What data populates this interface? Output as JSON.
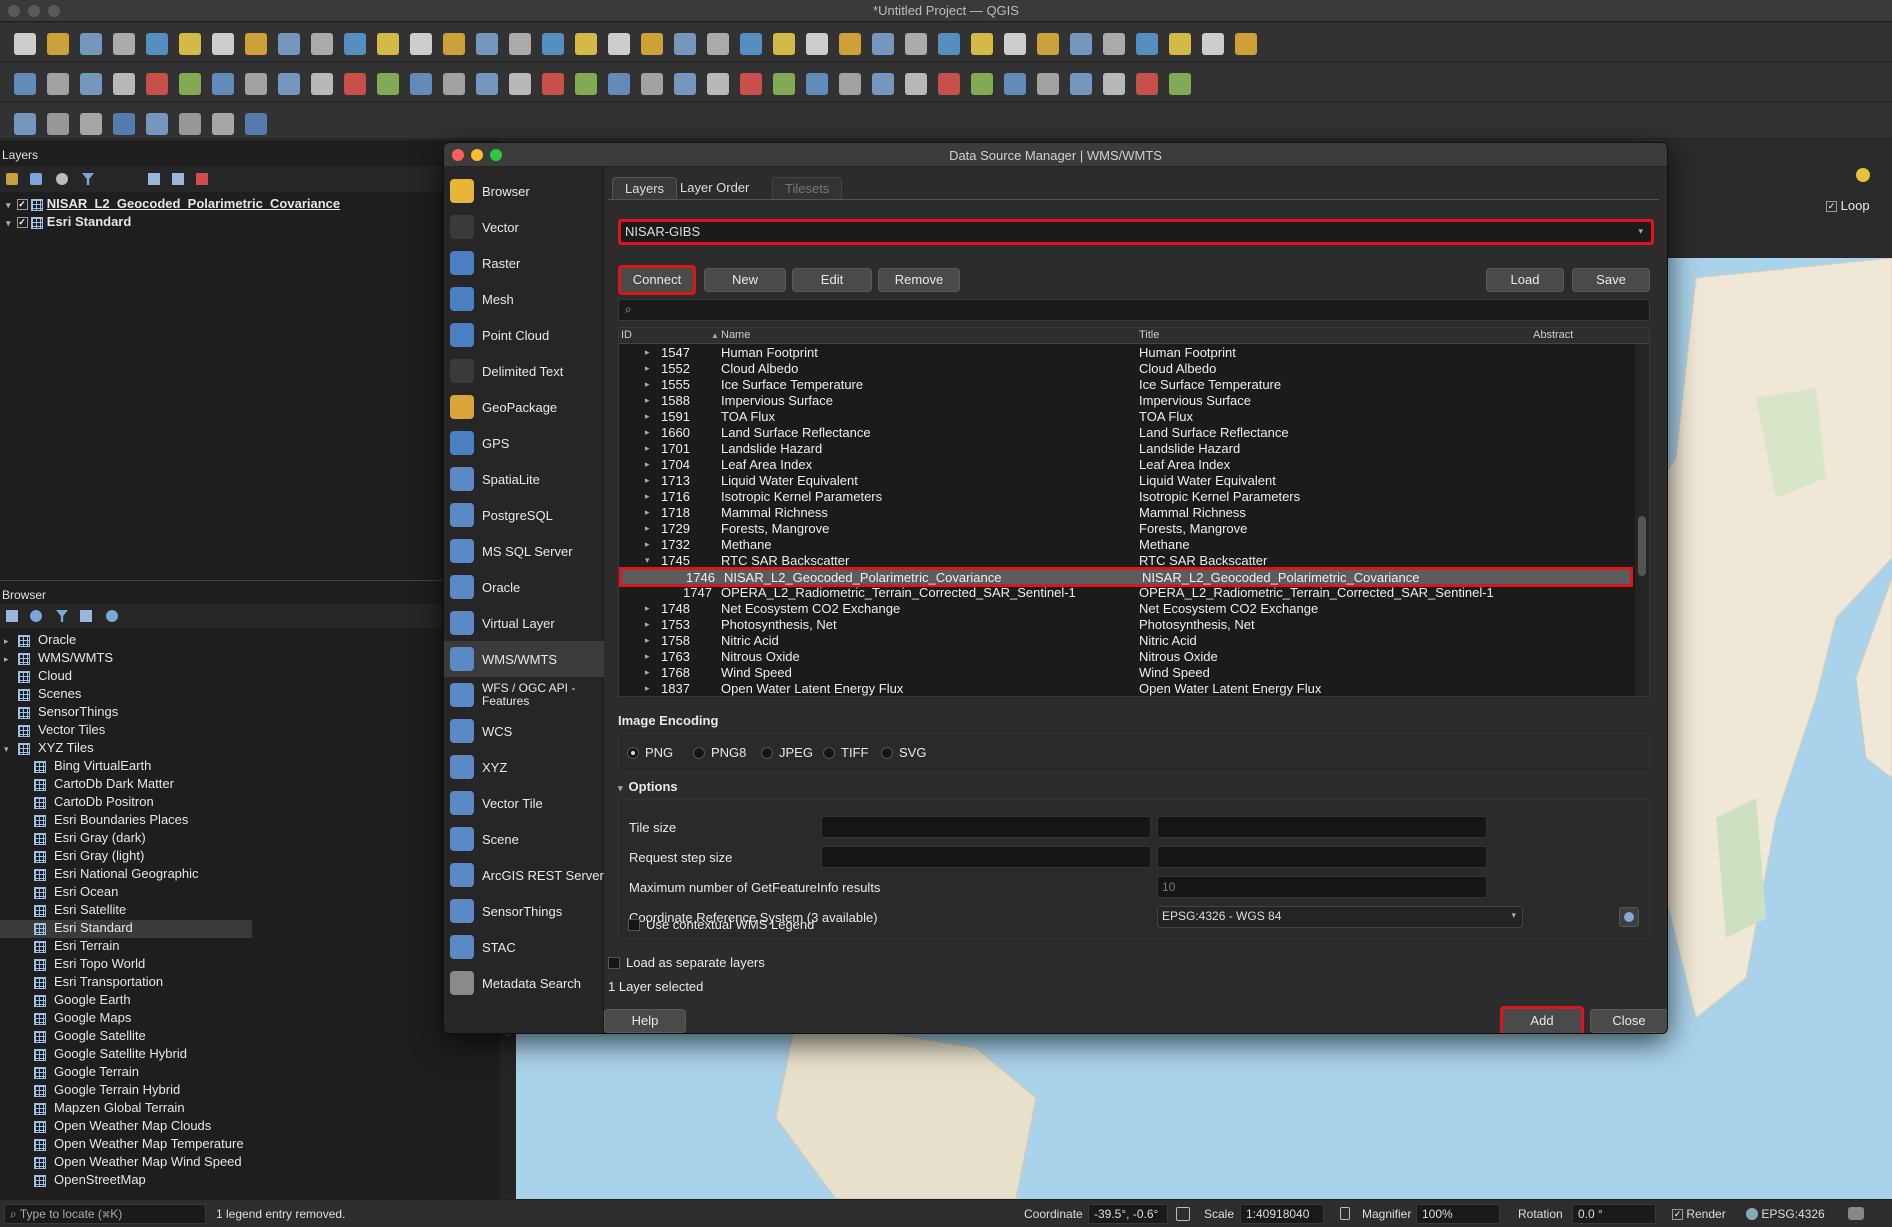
{
  "window": {
    "title": "*Untitled Project — QGIS"
  },
  "layers_panel": {
    "header": "Layers",
    "items": [
      {
        "name": "NISAR_L2_Geocoded_Polarimetric_Covariance",
        "checked": true
      },
      {
        "name": "Esri Standard",
        "checked": true
      }
    ]
  },
  "browser_panel": {
    "header": "Browser",
    "items": [
      {
        "label": "Oracle",
        "indent": 0,
        "expander": "▸"
      },
      {
        "label": "WMS/WMTS",
        "indent": 0,
        "expander": "▸"
      },
      {
        "label": "Cloud",
        "indent": 0,
        "expander": ""
      },
      {
        "label": "Scenes",
        "indent": 0,
        "expander": ""
      },
      {
        "label": "SensorThings",
        "indent": 0,
        "expander": ""
      },
      {
        "label": "Vector Tiles",
        "indent": 0,
        "expander": ""
      },
      {
        "label": "XYZ Tiles",
        "indent": 0,
        "expander": "▾"
      },
      {
        "label": "Bing VirtualEarth",
        "indent": 1
      },
      {
        "label": "CartoDb Dark Matter",
        "indent": 1
      },
      {
        "label": "CartoDb Positron",
        "indent": 1
      },
      {
        "label": "Esri Boundaries Places",
        "indent": 1
      },
      {
        "label": "Esri Gray (dark)",
        "indent": 1
      },
      {
        "label": "Esri Gray (light)",
        "indent": 1
      },
      {
        "label": "Esri National Geographic",
        "indent": 1
      },
      {
        "label": "Esri Ocean",
        "indent": 1
      },
      {
        "label": "Esri Satellite",
        "indent": 1
      },
      {
        "label": "Esri Standard",
        "indent": 1,
        "selected": true
      },
      {
        "label": "Esri Terrain",
        "indent": 1
      },
      {
        "label": "Esri Topo World",
        "indent": 1
      },
      {
        "label": "Esri Transportation",
        "indent": 1
      },
      {
        "label": "Google Earth",
        "indent": 1
      },
      {
        "label": "Google Maps",
        "indent": 1
      },
      {
        "label": "Google Satellite",
        "indent": 1
      },
      {
        "label": "Google Satellite Hybrid",
        "indent": 1
      },
      {
        "label": "Google Terrain",
        "indent": 1
      },
      {
        "label": "Google Terrain Hybrid",
        "indent": 1
      },
      {
        "label": "Mapzen Global Terrain",
        "indent": 1
      },
      {
        "label": "Open Weather Map Clouds",
        "indent": 1
      },
      {
        "label": "Open Weather Map Temperature",
        "indent": 1
      },
      {
        "label": "Open Weather Map Wind Speed",
        "indent": 1
      },
      {
        "label": "OpenStreetMap",
        "indent": 1
      }
    ]
  },
  "dialog": {
    "title": "Data Source Manager | WMS/WMTS",
    "sources": [
      {
        "label": "Browser",
        "icon": "folder-icon",
        "color": "#e8b53a"
      },
      {
        "label": "Vector",
        "icon": "vector-icon",
        "color": "#3a3a3a"
      },
      {
        "label": "Raster",
        "icon": "raster-icon",
        "color": "#4a7fc1"
      },
      {
        "label": "Mesh",
        "icon": "mesh-icon",
        "color": "#4a7fc1"
      },
      {
        "label": "Point Cloud",
        "icon": "point-cloud-icon",
        "color": "#4a7fc1"
      },
      {
        "label": "Delimited Text",
        "icon": "delimited-text-icon",
        "color": "#3a3a3a"
      },
      {
        "label": "GeoPackage",
        "icon": "geopackage-icon",
        "color": "#d9a43a"
      },
      {
        "label": "GPS",
        "icon": "gps-icon",
        "color": "#4a7fc1"
      },
      {
        "label": "SpatiaLite",
        "icon": "spatialite-icon",
        "color": "#5a8ac6"
      },
      {
        "label": "PostgreSQL",
        "icon": "postgresql-icon",
        "color": "#5a8ac6"
      },
      {
        "label": "MS SQL Server",
        "icon": "mssql-icon",
        "color": "#5a8ac6"
      },
      {
        "label": "Oracle",
        "icon": "oracle-icon",
        "color": "#5a8ac6"
      },
      {
        "label": "Virtual Layer",
        "icon": "virtual-layer-icon",
        "color": "#5a8ac6"
      },
      {
        "label": "WMS/WMTS",
        "icon": "wms-icon",
        "color": "#5a8ac6",
        "selected": true
      },
      {
        "label": "WFS / OGC API - Features",
        "icon": "wfs-icon",
        "color": "#5a8ac6"
      },
      {
        "label": "WCS",
        "icon": "wcs-icon",
        "color": "#5a8ac6"
      },
      {
        "label": "XYZ",
        "icon": "xyz-icon",
        "color": "#5a8ac6"
      },
      {
        "label": "Vector Tile",
        "icon": "vector-tile-icon",
        "color": "#5a8ac6"
      },
      {
        "label": "Scene",
        "icon": "scene-icon",
        "color": "#5a8ac6"
      },
      {
        "label": "ArcGIS REST Server",
        "icon": "arcgis-icon",
        "color": "#5a8ac6"
      },
      {
        "label": "SensorThings",
        "icon": "sensorthings-icon",
        "color": "#5a8ac6"
      },
      {
        "label": "STAC",
        "icon": "stac-icon",
        "color": "#5a8ac6"
      },
      {
        "label": "Metadata Search",
        "icon": "search-icon",
        "color": "#8a8a8a"
      }
    ],
    "tabs": {
      "layers": "Layers",
      "layer_order": "Layer Order",
      "tilesets": "Tilesets"
    },
    "connection": "NISAR-GIBS",
    "buttons": {
      "connect": "Connect",
      "new": "New",
      "edit": "Edit",
      "remove": "Remove",
      "load": "Load",
      "save": "Save"
    },
    "table": {
      "headers": {
        "id": "ID",
        "name": "Name",
        "title": "Title",
        "abstract": "Abstract"
      },
      "rows": [
        {
          "id": "1547",
          "name": "Human Footprint",
          "title": "Human Footprint",
          "expander": "▸"
        },
        {
          "id": "1552",
          "name": "Cloud Albedo",
          "title": "Cloud Albedo",
          "expander": "▸"
        },
        {
          "id": "1555",
          "name": "Ice Surface Temperature",
          "title": "Ice Surface Temperature",
          "expander": "▸"
        },
        {
          "id": "1588",
          "name": "Impervious Surface",
          "title": "Impervious Surface",
          "expander": "▸"
        },
        {
          "id": "1591",
          "name": "TOA Flux",
          "title": "TOA Flux",
          "expander": "▸"
        },
        {
          "id": "1660",
          "name": "Land Surface Reflectance",
          "title": "Land Surface Reflectance",
          "expander": "▸"
        },
        {
          "id": "1701",
          "name": "Landslide Hazard",
          "title": "Landslide Hazard",
          "expander": "▸"
        },
        {
          "id": "1704",
          "name": "Leaf Area Index",
          "title": "Leaf Area Index",
          "expander": "▸"
        },
        {
          "id": "1713",
          "name": "Liquid Water Equivalent",
          "title": "Liquid Water Equivalent",
          "expander": "▸"
        },
        {
          "id": "1716",
          "name": "Isotropic Kernel Parameters",
          "title": "Isotropic Kernel Parameters",
          "expander": "▸"
        },
        {
          "id": "1718",
          "name": "Mammal Richness",
          "title": "Mammal Richness",
          "expander": "▸"
        },
        {
          "id": "1729",
          "name": "Forests, Mangrove",
          "title": "Forests, Mangrove",
          "expander": "▸"
        },
        {
          "id": "1732",
          "name": "Methane",
          "title": "Methane",
          "expander": "▸"
        },
        {
          "id": "1745",
          "name": "RTC SAR Backscatter",
          "title": "RTC SAR Backscatter",
          "expander": "▾"
        },
        {
          "id": "1746",
          "name": "NISAR_L2_Geocoded_Polarimetric_Covariance",
          "title": "NISAR_L2_Geocoded_Polarimetric_Covariance",
          "expander": "",
          "child": true,
          "selected": true
        },
        {
          "id": "1747",
          "name": "OPERA_L2_Radiometric_Terrain_Corrected_SAR_Sentinel-1",
          "title": "OPERA_L2_Radiometric_Terrain_Corrected_SAR_Sentinel-1",
          "expander": "",
          "child": true
        },
        {
          "id": "1748",
          "name": "Net Ecosystem CO2 Exchange",
          "title": "Net Ecosystem CO2 Exchange",
          "expander": "▸"
        },
        {
          "id": "1753",
          "name": "Photosynthesis, Net",
          "title": "Photosynthesis, Net",
          "expander": "▸"
        },
        {
          "id": "1758",
          "name": "Nitric Acid",
          "title": "Nitric Acid",
          "expander": "▸"
        },
        {
          "id": "1763",
          "name": "Nitrous Oxide",
          "title": "Nitrous Oxide",
          "expander": "▸"
        },
        {
          "id": "1768",
          "name": "Wind Speed",
          "title": "Wind Speed",
          "expander": "▸"
        },
        {
          "id": "1837",
          "name": "Open Water Latent Energy Flux",
          "title": "Open Water Latent Energy Flux",
          "expander": "▸"
        }
      ]
    },
    "image_encoding": {
      "label": "Image Encoding",
      "options": [
        "PNG",
        "PNG8",
        "JPEG",
        "TIFF",
        "SVG"
      ],
      "selected": "PNG"
    },
    "options": {
      "label": "Options",
      "tile_size": "Tile size",
      "request_step_size": "Request step size",
      "max_featureinfo": "Maximum number of GetFeatureInfo results",
      "max_featureinfo_value": "10",
      "crs_label": "Coordinate Reference System (3 available)",
      "crs_value": "EPSG:4326 - WGS 84",
      "contextual_legend": "Use contextual WMS Legend"
    },
    "load_separate": "Load as separate layers",
    "status": "1 Layer selected",
    "help": "Help",
    "add": "Add",
    "close": "Close"
  },
  "map": {
    "loop_label": "Loop"
  },
  "statusbar": {
    "locate_placeholder": "Type to locate (⌘K)",
    "message": "1 legend entry removed.",
    "coordinate_label": "Coordinate",
    "coordinate_value": "-39.5°, -0.6°",
    "scale_label": "Scale",
    "scale_value": "1:40918040",
    "magnifier_label": "Magnifier",
    "magnifier_value": "100%",
    "rotation_label": "Rotation",
    "rotation_value": "0.0 °",
    "render_label": "Render",
    "crs": "EPSG:4326"
  },
  "colors": {
    "highlight_red": "#e0141b",
    "accent_blue": "#5a8ac6"
  }
}
